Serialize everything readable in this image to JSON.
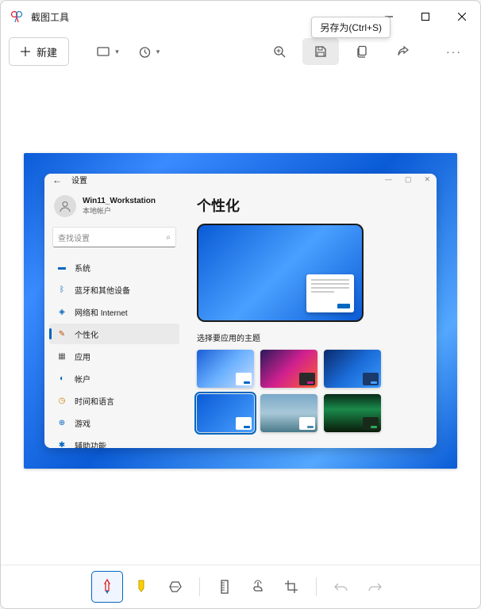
{
  "app": {
    "title": "截图工具"
  },
  "tooltip": {
    "save_as": "另存为(Ctrl+S)"
  },
  "toolbar": {
    "new_label": "新建"
  },
  "settings": {
    "window_title": "设置",
    "profile": {
      "name": "Win11_Workstation",
      "type": "本地帐户"
    },
    "search_placeholder": "查找设置",
    "nav": {
      "system": "系统",
      "bluetooth": "蓝牙和其他设备",
      "network": "网络和 Internet",
      "personalization": "个性化",
      "apps": "应用",
      "accounts": "帐户",
      "time": "时间和语言",
      "gaming": "游戏",
      "accessibility": "辅助功能"
    },
    "page": {
      "title": "个性化",
      "theme_label": "选择要应用的主题"
    }
  }
}
